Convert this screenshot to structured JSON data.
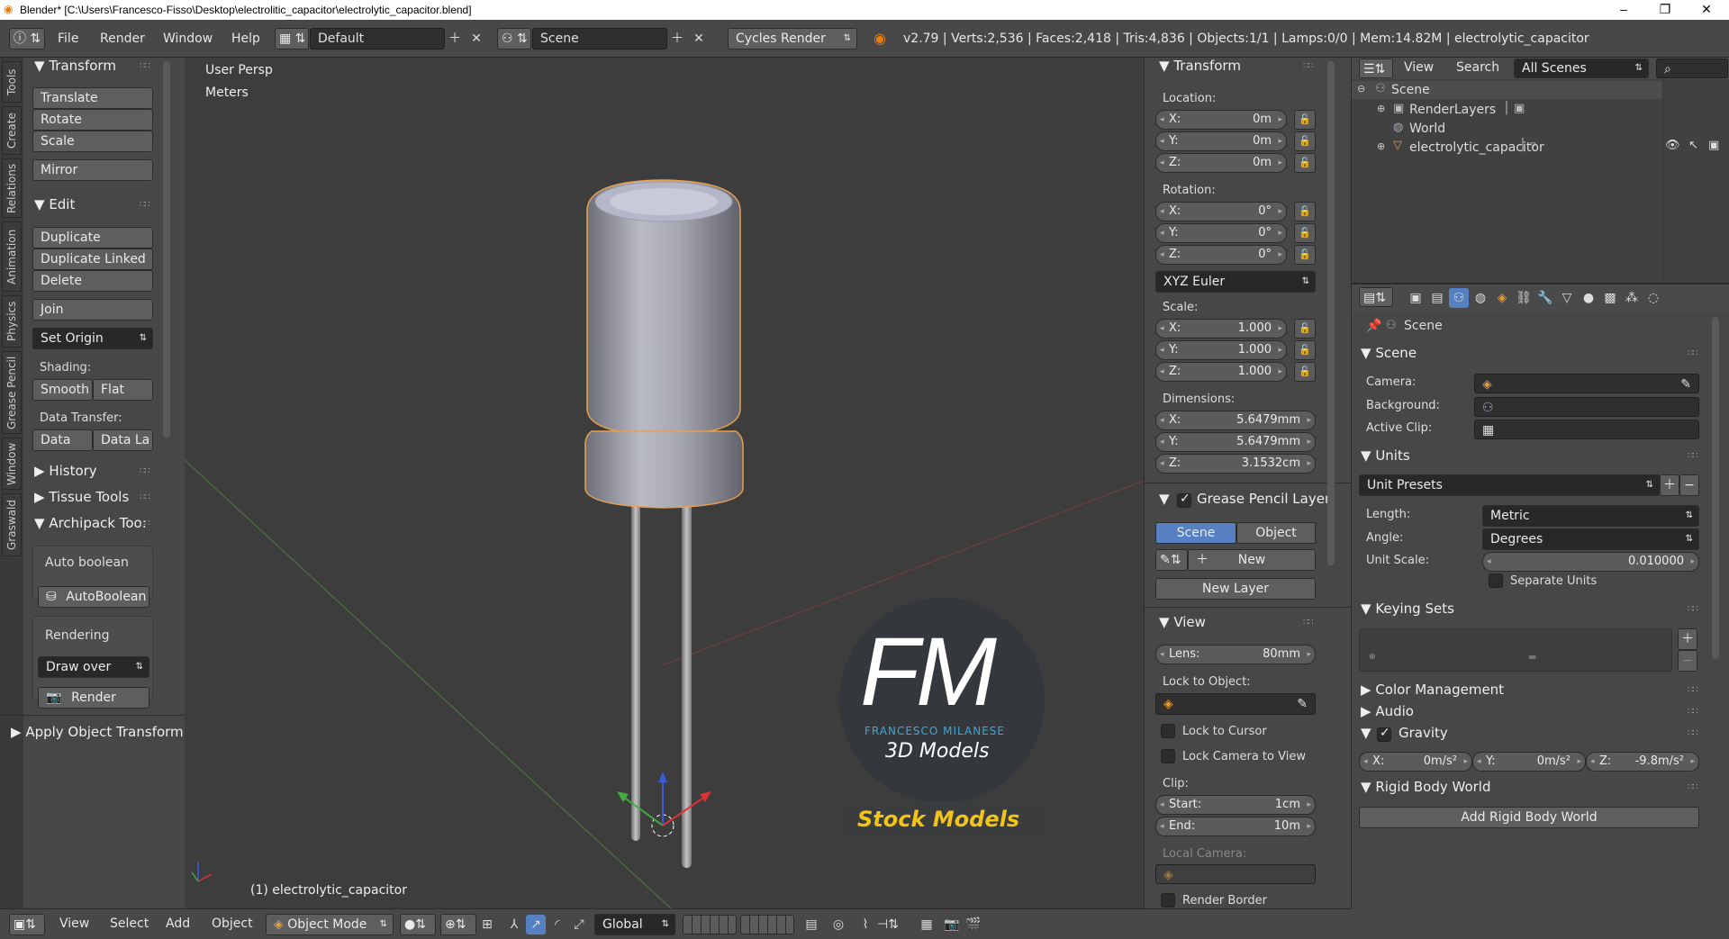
{
  "window": {
    "title": "Blender* [C:\\Users\\Francesco-Fisso\\Desktop\\electrolitic_capacitor\\electrolytic_capacitor.blend]",
    "min": "–",
    "max": "❐",
    "close": "✕"
  },
  "topmenu": {
    "items": [
      "File",
      "Render",
      "Window",
      "Help"
    ],
    "layout": "Default",
    "scene": "Scene",
    "engine": "Cycles Render",
    "stats": "v2.79 | Verts:2,536 | Faces:2,418 | Tris:4,836 | Objects:1/1 | Lamps:0/0 | Mem:14.82M | electrolytic_capacitor"
  },
  "toolshelf": {
    "tabs": [
      "Tools",
      "Create",
      "Relations",
      "Animation",
      "Physics",
      "Grease Pencil",
      "Window",
      "Graswald"
    ],
    "transform": {
      "title": "Transform",
      "buttons": [
        "Translate",
        "Rotate",
        "Scale",
        "Mirror"
      ]
    },
    "edit": {
      "title": "Edit",
      "buttons": [
        "Duplicate",
        "Duplicate Linked",
        "Delete",
        "Join"
      ],
      "set_origin": "Set Origin",
      "shading_label": "Shading:",
      "smooth": "Smooth",
      "flat": "Flat",
      "data_transfer_label": "Data Transfer:",
      "data": "Data",
      "data_la": "Data La"
    },
    "history": "History",
    "tissue": "Tissue Tools",
    "archipack": "Archipack Too:",
    "auto_boolean_label": "Auto boolean",
    "auto_boolean_btn": "AutoBoolean",
    "rendering_label": "Rendering",
    "draw_over": "Draw over",
    "render_btn": "Render",
    "operator": "Apply Object Transform"
  },
  "viewport": {
    "view_name": "User Persp",
    "units": "Meters",
    "object_label": "(1) electrolytic_capacitor",
    "watermark": {
      "letters": "FM",
      "name": "FRANCESCO MILANESE",
      "sub": "3D Models",
      "banner": "Stock Models"
    }
  },
  "npanel": {
    "transform_title": "Transform",
    "location_label": "Location:",
    "location": [
      {
        "l": "X:",
        "v": "0m"
      },
      {
        "l": "Y:",
        "v": "0m"
      },
      {
        "l": "Z:",
        "v": "0m"
      }
    ],
    "rotation_label": "Rotation:",
    "rotation": [
      {
        "l": "X:",
        "v": "0°"
      },
      {
        "l": "Y:",
        "v": "0°"
      },
      {
        "l": "Z:",
        "v": "0°"
      }
    ],
    "rotation_mode": "XYZ Euler",
    "scale_label": "Scale:",
    "scale": [
      {
        "l": "X:",
        "v": "1.000"
      },
      {
        "l": "Y:",
        "v": "1.000"
      },
      {
        "l": "Z:",
        "v": "1.000"
      }
    ],
    "dimensions_label": "Dimensions:",
    "dimensions": [
      {
        "l": "X:",
        "v": "5.6479mm"
      },
      {
        "l": "Y:",
        "v": "5.6479mm"
      },
      {
        "l": "Z:",
        "v": "3.1532cm"
      }
    ],
    "grease_title": "Grease Pencil Layer",
    "gp_scene": "Scene",
    "gp_object": "Object",
    "gp_new": "New",
    "gp_new_layer": "New Layer",
    "view_title": "View",
    "lens_label": "Lens:",
    "lens": "80mm",
    "lock_object_label": "Lock to Object:",
    "lock_cursor": "Lock to Cursor",
    "lock_camera": "Lock Camera to View",
    "clip_label": "Clip:",
    "clip_start_label": "Start:",
    "clip_start": "1cm",
    "clip_end_label": "End:",
    "clip_end": "10m",
    "local_camera": "Local Camera:",
    "render_border": "Render Border"
  },
  "outliner": {
    "view": "View",
    "search": "Search",
    "filter": "All Scenes",
    "tree": [
      "Scene",
      "RenderLayers",
      "World",
      "electrolytic_capacitor"
    ]
  },
  "properties": {
    "context": "Scene",
    "scene_title": "Scene",
    "camera_label": "Camera:",
    "background_label": "Background:",
    "clip_label": "Active Clip:",
    "units_title": "Units",
    "unit_presets": "Unit Presets",
    "length_label": "Length:",
    "length": "Metric",
    "angle_label": "Angle:",
    "angle": "Degrees",
    "unit_scale_label": "Unit Scale:",
    "unit_scale": "0.010000",
    "separate_units": "Separate Units",
    "keying_title": "Keying Sets",
    "color_mgmt": "Color Management",
    "audio": "Audio",
    "gravity_title": "Gravity",
    "gravity": [
      {
        "l": "X:",
        "v": "0m/s²"
      },
      {
        "l": "Y:",
        "v": "0m/s²"
      },
      {
        "l": "Z:",
        "v": "-9.8m/s²"
      }
    ],
    "rigid_title": "Rigid Body World",
    "add_rigid": "Add Rigid Body World"
  },
  "bottom": {
    "view": "View",
    "select": "Select",
    "add": "Add",
    "object": "Object",
    "mode": "Object Mode",
    "orientation": "Global"
  }
}
